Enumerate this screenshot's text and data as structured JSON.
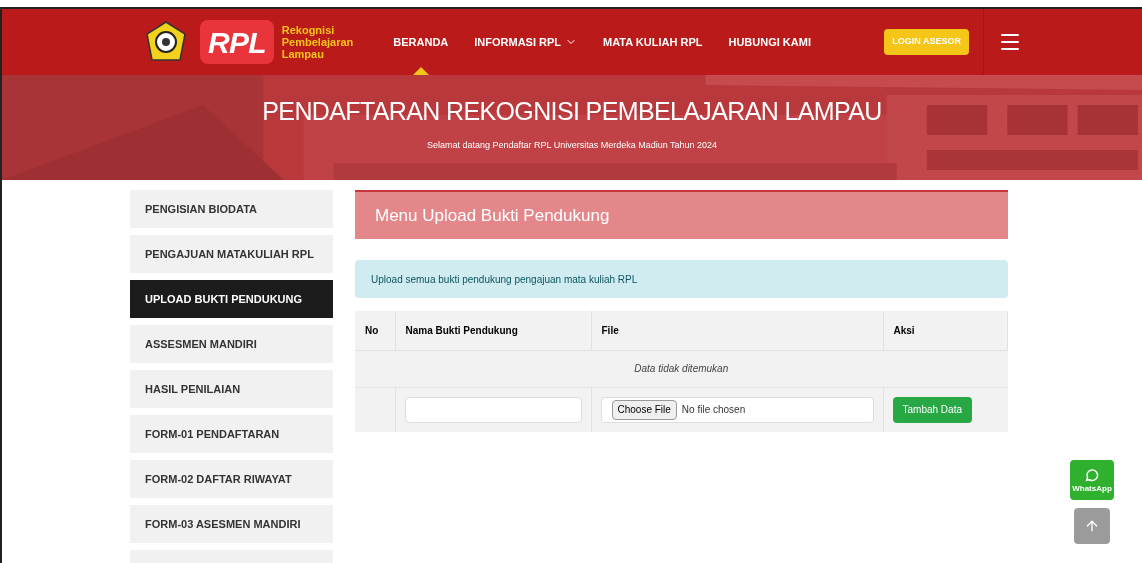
{
  "header": {
    "logo_text": "RPL",
    "logo_caption": [
      "Rekognisi",
      "Pembelajaran",
      "Lampau"
    ],
    "nav": [
      {
        "label": "BERANDA",
        "selected": true,
        "dropdown": false
      },
      {
        "label": "INFORMASI RPL",
        "selected": false,
        "dropdown": true
      },
      {
        "label": "MATA KULIAH RPL",
        "selected": false,
        "dropdown": false
      },
      {
        "label": "HUBUNGI KAMI",
        "selected": false,
        "dropdown": false
      }
    ],
    "login_button": "LOGIN ASESOR"
  },
  "hero": {
    "title": "PENDAFTARAN REKOGNISI PEMBELAJARAN LAMPAU",
    "subtitle": "Selamat datang Pendaftar RPL Universitas Merdeka Madiun Tahun 2024"
  },
  "sidebar": {
    "items": [
      {
        "label": "PENGISIAN BIODATA",
        "selected": false
      },
      {
        "label": "PENGAJUAN MATAKULIAH RPL",
        "selected": false
      },
      {
        "label": "UPLOAD BUKTI PENDUKUNG",
        "selected": true
      },
      {
        "label": "ASSESMEN MANDIRI",
        "selected": false
      },
      {
        "label": "HASIL PENILAIAN",
        "selected": false
      },
      {
        "label": "FORM-01 PENDAFTARAN",
        "selected": false
      },
      {
        "label": "FORM-02 DAFTAR RIWAYAT",
        "selected": false
      },
      {
        "label": "FORM-03 ASESMEN MANDIRI",
        "selected": false
      }
    ]
  },
  "panel": {
    "title": "Menu Upload Bukti Pendukung",
    "alert": "Upload semua bukti pendukung pengajuan mata kuliah RPL",
    "table": {
      "columns": [
        "No",
        "Nama Bukti Pendukung",
        "File",
        "Aksi"
      ],
      "empty_message": "Data tidak ditemukan",
      "form_row": {
        "file_button": "Choose File",
        "file_status": "No file chosen",
        "submit": "Tambah Data"
      }
    }
  },
  "floating": {
    "whatsapp_label": "WhatsApp"
  }
}
